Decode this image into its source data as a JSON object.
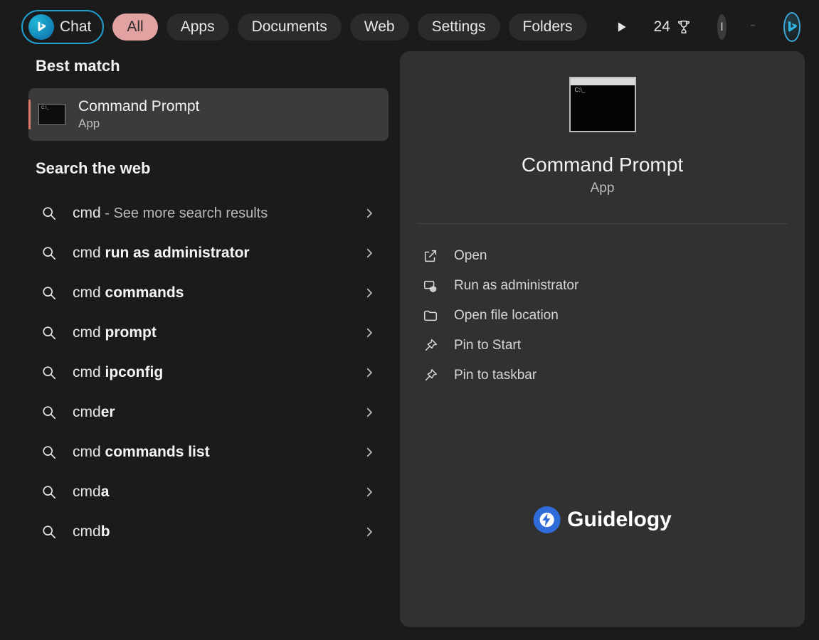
{
  "tabs": {
    "chat": "Chat",
    "all": "All",
    "apps": "Apps",
    "documents": "Documents",
    "web": "Web",
    "settings": "Settings",
    "folders": "Folders"
  },
  "rewards_points": "24",
  "avatar_initial": "I",
  "sections": {
    "best_match": "Best match",
    "search_web": "Search the web"
  },
  "best_match": {
    "title": "Command Prompt",
    "subtitle": "App"
  },
  "web_results": [
    {
      "prefix": "cmd",
      "bold": "",
      "hint": " - See more search results"
    },
    {
      "prefix": "cmd ",
      "bold": "run as administrator",
      "hint": ""
    },
    {
      "prefix": "cmd ",
      "bold": "commands",
      "hint": ""
    },
    {
      "prefix": "cmd ",
      "bold": "prompt",
      "hint": ""
    },
    {
      "prefix": "cmd ",
      "bold": "ipconfig",
      "hint": ""
    },
    {
      "prefix": "cmd",
      "bold": "er",
      "hint": ""
    },
    {
      "prefix": "cmd ",
      "bold": "commands list",
      "hint": ""
    },
    {
      "prefix": "cmd",
      "bold": "a",
      "hint": ""
    },
    {
      "prefix": "cmd",
      "bold": "b",
      "hint": ""
    }
  ],
  "preview": {
    "title": "Command Prompt",
    "subtitle": "App"
  },
  "actions": [
    {
      "icon": "open-icon",
      "label": "Open"
    },
    {
      "icon": "admin-icon",
      "label": "Run as administrator"
    },
    {
      "icon": "folder-icon",
      "label": "Open file location"
    },
    {
      "icon": "pin-icon",
      "label": "Pin to Start"
    },
    {
      "icon": "pin-icon",
      "label": "Pin to taskbar"
    }
  ],
  "watermark": "Guidelogy"
}
